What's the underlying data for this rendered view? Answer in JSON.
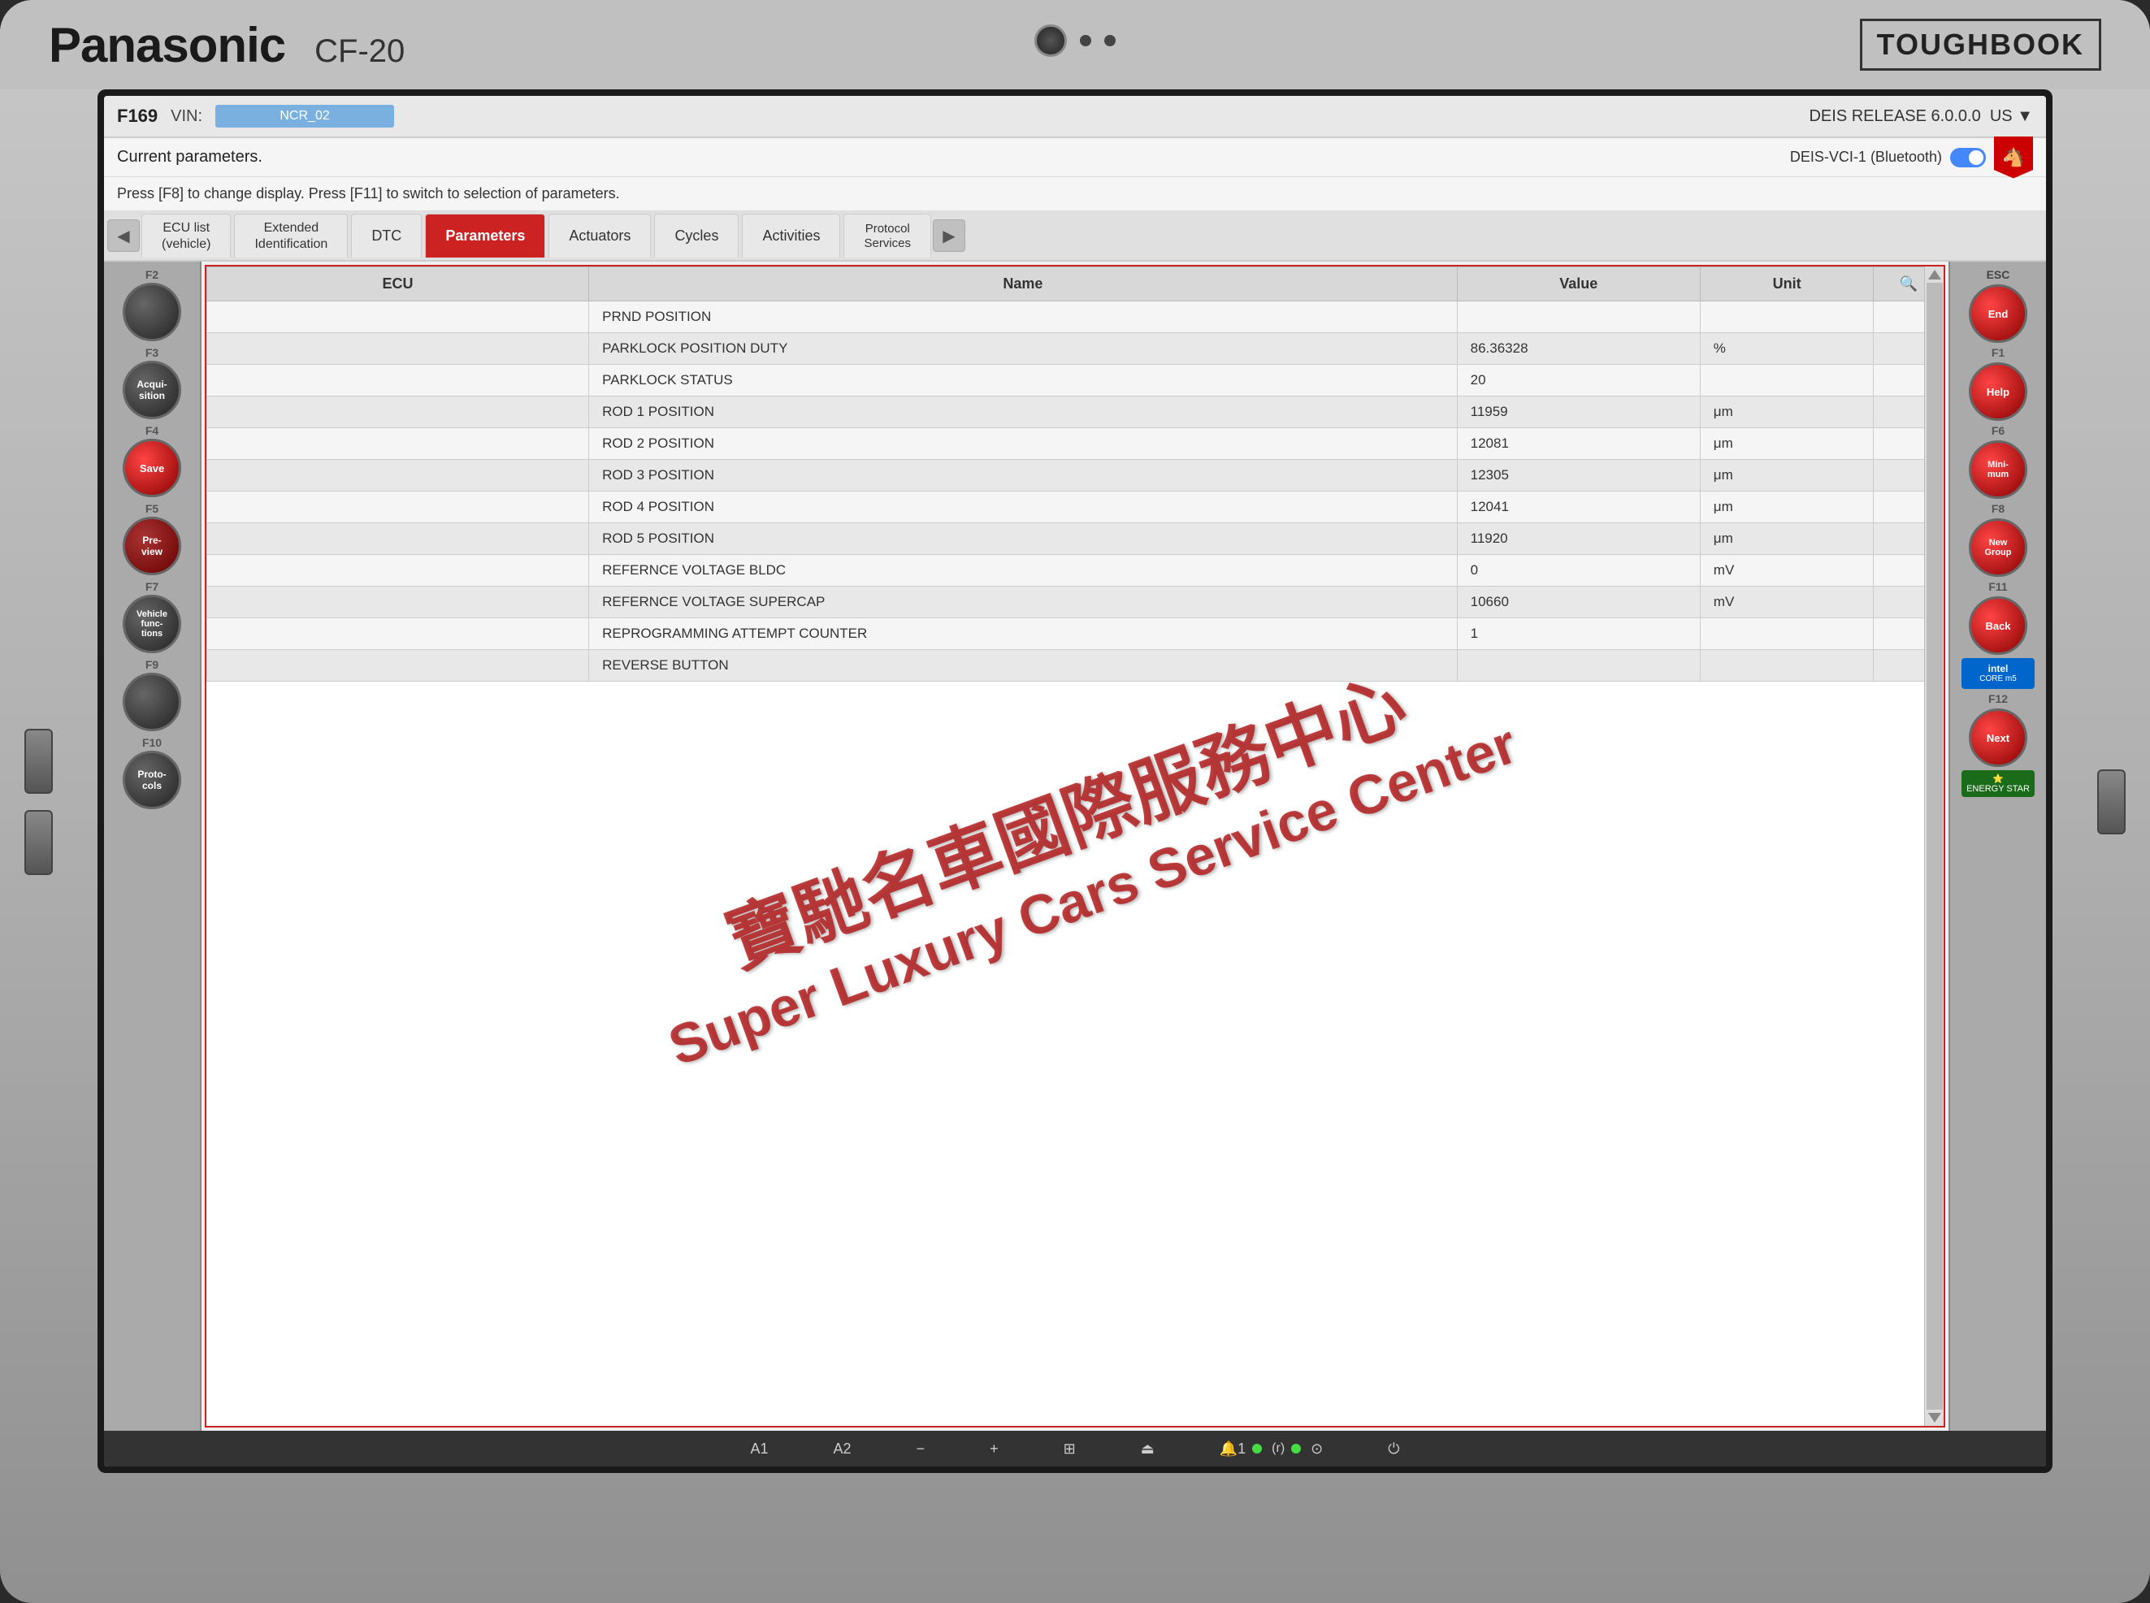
{
  "laptop": {
    "brand": "Panasonic",
    "model": "CF-20",
    "series": "TOUGHBOOK"
  },
  "topbar": {
    "f_code": "F169",
    "vin_label": "VIN:",
    "vin_value": "NCR_02",
    "release": "DEIS RELEASE 6.0.0.0",
    "region": "US"
  },
  "infobar": {
    "current_params": "Current parameters.",
    "press_text": "Press [F8] to change display. Press [F11] to switch to selection of parameters.",
    "connection": "DEIS-VCI-1 (Bluetooth)"
  },
  "tabs": [
    {
      "id": "ecu-list",
      "label": "ECU list\n(vehicle)"
    },
    {
      "id": "extended-id",
      "label": "Extended\nIdentification"
    },
    {
      "id": "dtc",
      "label": "DTC"
    },
    {
      "id": "parameters",
      "label": "Parameters",
      "active": true
    },
    {
      "id": "actuators",
      "label": "Actuators"
    },
    {
      "id": "cycles",
      "label": "Cycles"
    },
    {
      "id": "activities",
      "label": "Activities"
    },
    {
      "id": "protocol-services",
      "label": "Protocol\nServices"
    }
  ],
  "table": {
    "headers": [
      "ECU",
      "Name",
      "Value",
      "Unit"
    ],
    "rows": [
      {
        "ecu": "",
        "name": "PRND POSITION",
        "value": "",
        "unit": ""
      },
      {
        "ecu": "",
        "name": "PARKLOCK POSITION DUTY",
        "value": "86.36328",
        "unit": "%"
      },
      {
        "ecu": "",
        "name": "PARKLOCK STATUS",
        "value": "20",
        "unit": ""
      },
      {
        "ecu": "",
        "name": "ROD 1 POSITION",
        "value": "11959",
        "unit": "μm"
      },
      {
        "ecu": "",
        "name": "ROD 2 POSITION",
        "value": "12081",
        "unit": "μm"
      },
      {
        "ecu": "",
        "name": "ROD 3 POSITION",
        "value": "12305",
        "unit": "μm"
      },
      {
        "ecu": "",
        "name": "ROD 4 POSITION",
        "value": "12041",
        "unit": "μm"
      },
      {
        "ecu": "",
        "name": "ROD 5 POSITION",
        "value": "11920",
        "unit": "μm"
      },
      {
        "ecu": "",
        "name": "REFERNCE VOLTAGE BLDC",
        "value": "0",
        "unit": "mV"
      },
      {
        "ecu": "",
        "name": "REFERNCE VOLTAGE SUPERCAP",
        "value": "10660",
        "unit": "mV"
      },
      {
        "ecu": "",
        "name": "REPROGRAMMING ATTEMPT COUNTER",
        "value": "1",
        "unit": ""
      },
      {
        "ecu": "",
        "name": "REVERSE BUTTON",
        "value": "",
        "unit": ""
      }
    ]
  },
  "left_buttons": [
    {
      "key": "F2",
      "label": "",
      "style": "dark"
    },
    {
      "key": "F3",
      "label": "Acquisition",
      "style": "dark"
    },
    {
      "key": "F4",
      "label": "Save",
      "style": "red"
    },
    {
      "key": "F5",
      "label": "Preview",
      "style": "dark-red"
    },
    {
      "key": "F7",
      "label": "Vehicle\nfunctions",
      "style": "dark"
    },
    {
      "key": "F9",
      "label": "",
      "style": "dark"
    },
    {
      "key": "F10",
      "label": "Protocols",
      "style": "dark"
    }
  ],
  "right_buttons": [
    {
      "key": "ESC",
      "label": "End",
      "style": "red"
    },
    {
      "key": "F1",
      "label": "Help",
      "style": "red"
    },
    {
      "key": "F6",
      "label": "Minimum",
      "style": "red"
    },
    {
      "key": "F8",
      "label": "New\nGroup",
      "style": "red"
    },
    {
      "key": "F11",
      "label": "Back",
      "style": "red"
    },
    {
      "key": "F12",
      "label": "Next",
      "style": "red"
    }
  ],
  "taskbar": {
    "items": [
      "A1",
      "A2",
      "−",
      "+",
      "⊞",
      "⏏",
      "🔔",
      "(r)",
      "●",
      "⊙",
      "⏻"
    ]
  },
  "watermark": {
    "zh": "寶馳名車國際服務中心",
    "en": "Super Luxury Cars Service Center"
  }
}
